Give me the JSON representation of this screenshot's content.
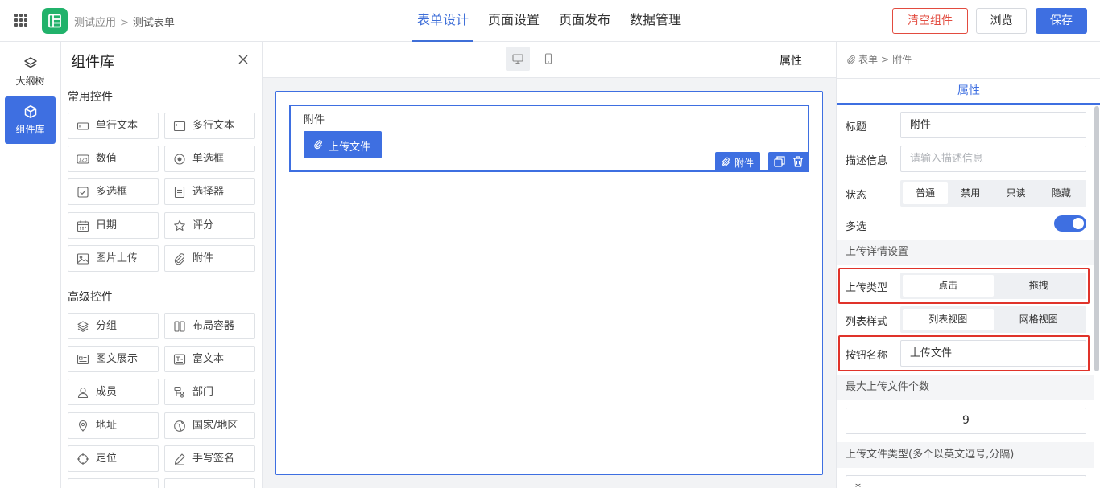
{
  "header": {
    "breadcrumb": [
      "测试应用",
      "测试表单"
    ],
    "breadcrumb_sep": ">",
    "tabs": [
      {
        "label": "表单设计",
        "active": true
      },
      {
        "label": "页面设置",
        "active": false
      },
      {
        "label": "页面发布",
        "active": false
      },
      {
        "label": "数据管理",
        "active": false
      }
    ],
    "clear_label": "清空组件",
    "preview_label": "浏览",
    "save_label": "保存"
  },
  "rail": [
    {
      "label": "大纲树",
      "icon": "layers-icon",
      "active": false
    },
    {
      "label": "组件库",
      "icon": "cube-icon",
      "active": true
    }
  ],
  "library": {
    "title": "组件库",
    "sections": [
      {
        "title": "常用控件",
        "items": [
          {
            "label": "单行文本",
            "icon": "single-line-text-icon"
          },
          {
            "label": "多行文本",
            "icon": "multi-line-text-icon"
          },
          {
            "label": "数值",
            "icon": "number-icon"
          },
          {
            "label": "单选框",
            "icon": "radio-icon"
          },
          {
            "label": "多选框",
            "icon": "checkbox-icon"
          },
          {
            "label": "选择器",
            "icon": "select-icon"
          },
          {
            "label": "日期",
            "icon": "calendar-icon"
          },
          {
            "label": "评分",
            "icon": "star-icon"
          },
          {
            "label": "图片上传",
            "icon": "image-icon"
          },
          {
            "label": "附件",
            "icon": "paperclip-icon"
          }
        ]
      },
      {
        "title": "高级控件",
        "items": [
          {
            "label": "分组",
            "icon": "layers-icon"
          },
          {
            "label": "布局容器",
            "icon": "columns-icon"
          },
          {
            "label": "图文展示",
            "icon": "card-icon"
          },
          {
            "label": "富文本",
            "icon": "rich-text-icon"
          },
          {
            "label": "成员",
            "icon": "user-icon"
          },
          {
            "label": "部门",
            "icon": "org-icon"
          },
          {
            "label": "地址",
            "icon": "map-pin-icon"
          },
          {
            "label": "国家/地区",
            "icon": "globe-icon"
          },
          {
            "label": "定位",
            "icon": "target-icon"
          },
          {
            "label": "手写签名",
            "icon": "pen-icon"
          }
        ]
      }
    ]
  },
  "canvas": {
    "toolbar_label": "属性",
    "field": {
      "label": "附件",
      "button_label": "上传文件",
      "tag_label": "附件"
    }
  },
  "props": {
    "breadcrumb": [
      "表单",
      "附件"
    ],
    "tab": "属性",
    "title_label": "标题",
    "title_value": "附件",
    "desc_label": "描述信息",
    "desc_placeholder": "请输入描述信息",
    "state_label": "状态",
    "state_options": [
      "普通",
      "禁用",
      "只读",
      "隐藏"
    ],
    "state_selected": "普通",
    "multi_label": "多选",
    "multi_on": true,
    "upload_section": "上传详情设置",
    "upload_type_label": "上传类型",
    "upload_type_options": [
      "点击",
      "拖拽"
    ],
    "upload_type_selected": "点击",
    "list_style_label": "列表样式",
    "list_style_options": [
      "列表视图",
      "网格视图"
    ],
    "list_style_selected": "列表视图",
    "btn_name_label": "按钮名称",
    "btn_name_value": "上传文件",
    "max_count_section": "最大上传文件个数",
    "max_count_value": "9",
    "file_type_section": "上传文件类型(多个以英文逗号,分隔)",
    "file_type_value": "*"
  },
  "colors": {
    "primary": "#3e6fe1",
    "danger": "#e24b3f",
    "highlight": "#e0332a",
    "logo": "#21b26b"
  }
}
